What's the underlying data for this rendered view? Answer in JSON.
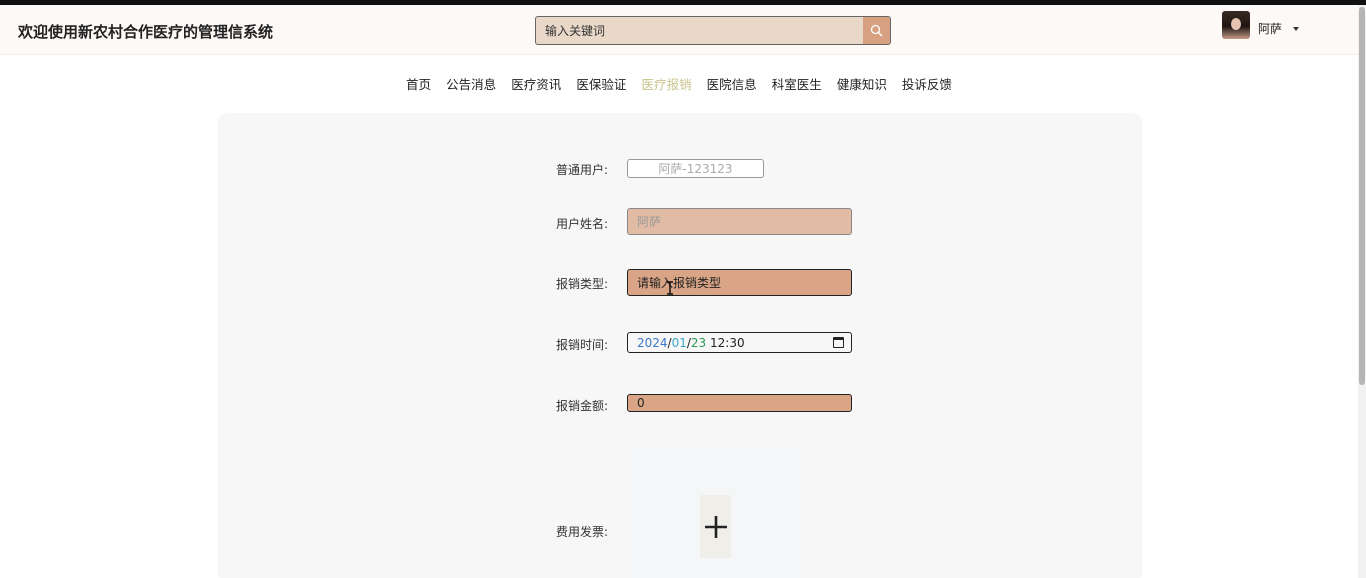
{
  "header": {
    "site_title": "欢迎使用新农村合作医疗的管理信系统",
    "search_placeholder": "输入关键词",
    "user_name": "阿萨"
  },
  "nav": {
    "items": [
      "首页",
      "公告消息",
      "医疗资讯",
      "医保验证",
      "医疗报销",
      "医院信息",
      "科室医生",
      "健康知识",
      "投诉反馈"
    ],
    "active": "医疗报销"
  },
  "form": {
    "user_label": "普通用户:",
    "user_value": "阿萨-123123",
    "name_label": "用户姓名:",
    "name_value": "阿萨",
    "type_label": "报销类型:",
    "type_placeholder": "请输入报销类型",
    "time_label": "报销时间:",
    "time_year": "2024",
    "time_month": "01",
    "time_day": "23",
    "time_clock": "12:30",
    "amount_label": "报销金额:",
    "amount_value": "0",
    "invoice_label": "费用发票:"
  },
  "colors": {
    "accent": "#d9a586",
    "nav_active": "#c8c38c",
    "search_bg": "#e9d8c8"
  }
}
